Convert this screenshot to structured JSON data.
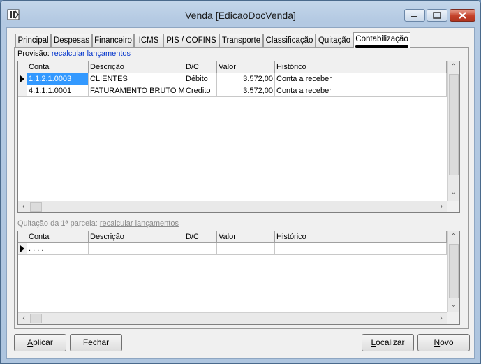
{
  "window": {
    "title": "Venda [EdicaoDocVenda]"
  },
  "tabs": [
    {
      "label": "Principal"
    },
    {
      "label": "Despesas"
    },
    {
      "label": "Financeiro"
    },
    {
      "label": "ICMS"
    },
    {
      "label": "PIS / COFINS"
    },
    {
      "label": "Transporte"
    },
    {
      "label": "Classificação"
    },
    {
      "label": "Quitação"
    },
    {
      "label": "Contabilização"
    }
  ],
  "provisao": {
    "label": "Provisão:",
    "link": "recalcular lançamentos",
    "columns": [
      "Conta",
      "Descrição",
      "D/C",
      "Valor",
      "Histórico"
    ],
    "rows": [
      {
        "conta": "1.1.2.1.0003",
        "descricao": "CLIENTES",
        "dc": "Débito",
        "valor": "3.572,00",
        "historico": "Conta a receber"
      },
      {
        "conta": "4.1.1.1.0001",
        "descricao": "FATURAMENTO BRUTO M",
        "dc": "Credito",
        "valor": "3.572,00",
        "historico": "Conta a receber"
      }
    ]
  },
  "quitacao": {
    "label": "Quitação da 1ª parcela:",
    "link": "recalcular lançamentos",
    "columns": [
      "Conta",
      "Descrição",
      "D/C",
      "Valor",
      "Histórico"
    ],
    "rows": [
      {
        "conta": ". . . .",
        "descricao": "",
        "dc": "",
        "valor": "",
        "historico": ""
      }
    ]
  },
  "buttons": {
    "aplicar": {
      "pre": "",
      "key": "A",
      "post": "plicar"
    },
    "fechar": {
      "pre": "",
      "key": "",
      "post": "Fechar"
    },
    "localizar": {
      "pre": "",
      "key": "L",
      "post": "ocalizar"
    },
    "novo": {
      "pre": "",
      "key": "N",
      "post": "ovo"
    }
  },
  "colors": {
    "selection": "#3399ff",
    "link": "#0033cc",
    "close": "#c4412a"
  }
}
